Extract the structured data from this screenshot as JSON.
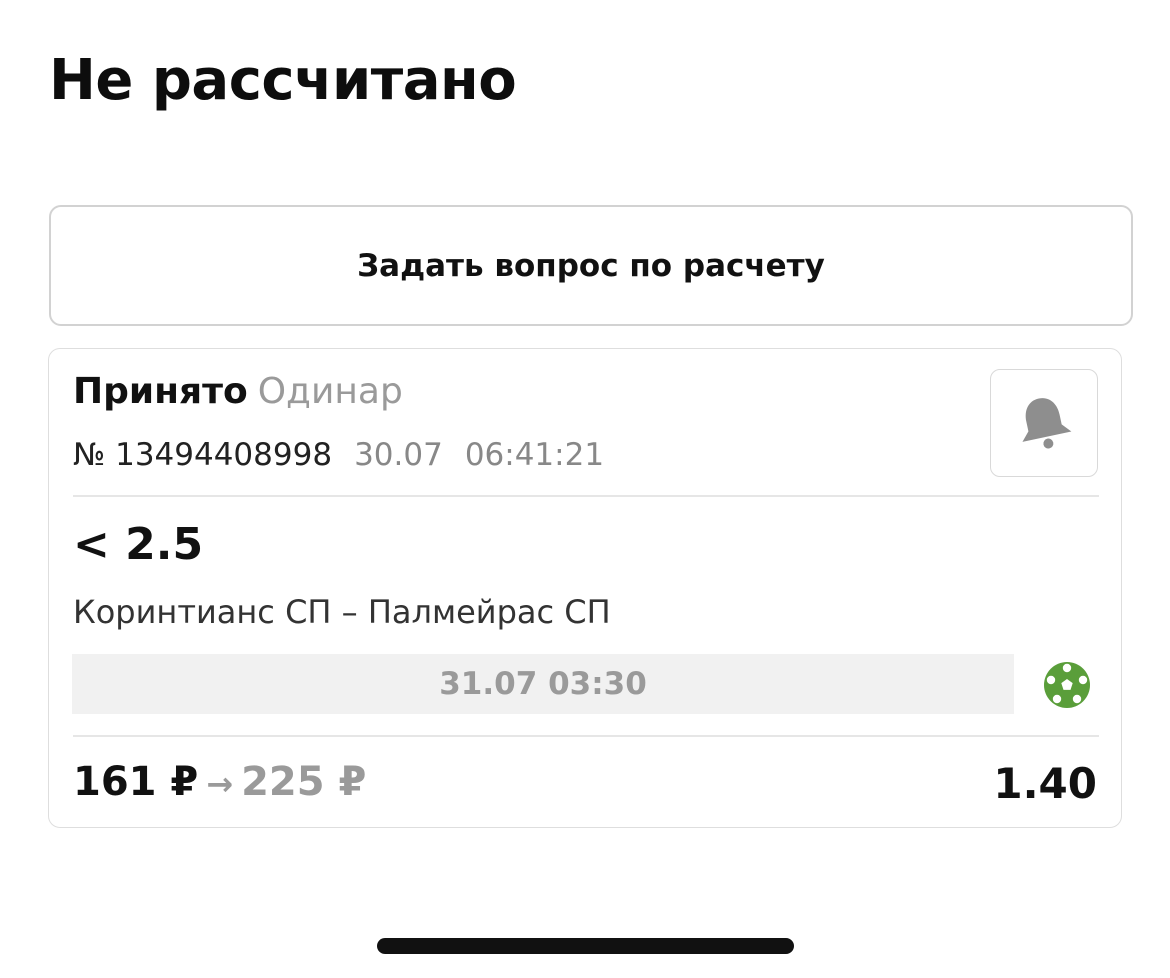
{
  "header": {
    "title": "Не рассчитано"
  },
  "actions": {
    "ask_question_label": "Задать вопрос по расчету"
  },
  "bet": {
    "status": "Принято",
    "type": "Одинар",
    "number": "№ 13494408998",
    "date": "30.07",
    "time": "06:41:21",
    "outcome": "< 2.5",
    "event": "Коринтианс СП – Палмейрас СП",
    "event_start": "31.07 03:30",
    "sport_icon": "soccer-ball-icon",
    "notify_icon": "bell-icon",
    "stake": "161 ₽",
    "arrow": "→",
    "payout": "225 ₽",
    "odds": "1.40"
  },
  "colors": {
    "sport_icon": "#5a9e3a",
    "muted_text": "#9a9a9a",
    "bell": "#8e8e8e"
  }
}
